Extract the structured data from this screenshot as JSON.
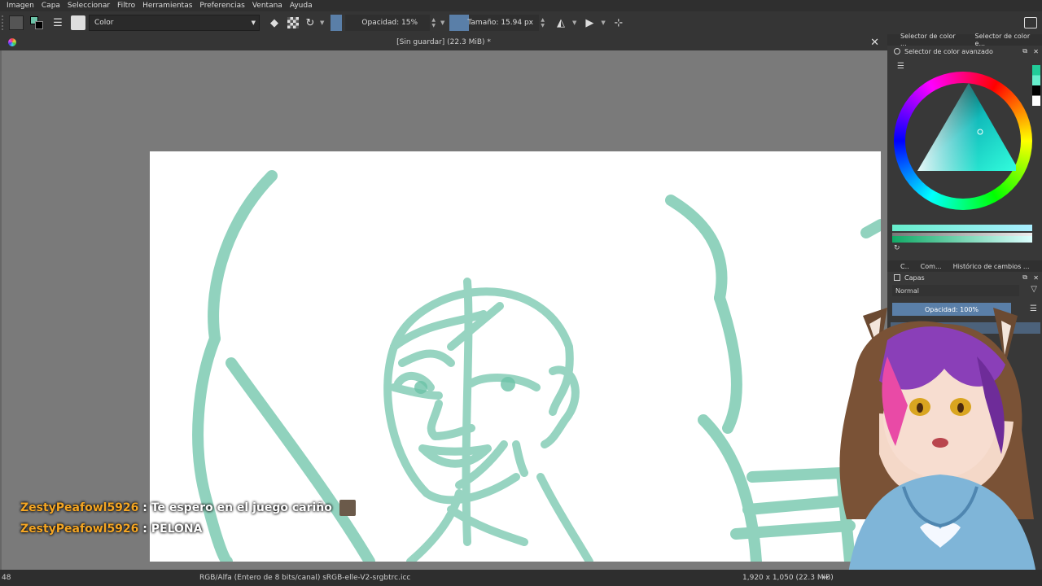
{
  "menu": [
    "Imagen",
    "Capa",
    "Seleccionar",
    "Filtro",
    "Herramientas",
    "Preferencias",
    "Ventana",
    "Ayuda"
  ],
  "toolbar": {
    "blend_mode": "Color",
    "opacity_label": "Opacidad: 15%",
    "size_label": "Tamaño: 15.94 px"
  },
  "document": {
    "title": "[Sin guardar]  (22.3 MiB) *"
  },
  "docker": {
    "top_tabs": [
      "Selector de color ...",
      "Selector de color e..."
    ],
    "color_panel_title": "Selector de color avanzado",
    "mid_tabs": [
      "C..",
      "Com...",
      "Histórico de cambios ..."
    ],
    "layers_title": "Capas",
    "blend": "Normal",
    "opacity": "Opacidad:  100%"
  },
  "chat": [
    {
      "user": "ZestyPeafowl5926",
      "sep": " : ",
      "text": "Te espero en el juego cariño"
    },
    {
      "user": "ZestyPeafowl5926",
      "sep": " : ",
      "text": "PELONA"
    }
  ],
  "status": {
    "left": "48",
    "colorspace": "RGB/Alfa (Entero de 8 bits/canal)  sRGB-elle-V2-srgbtrc.icc",
    "dimensions": "1,920 x 1,050 (22.3 MiB)"
  },
  "colors": {
    "sketch": "#6cc3a8",
    "accent": "#5a7fa8",
    "chat_user": "#f5a623"
  }
}
